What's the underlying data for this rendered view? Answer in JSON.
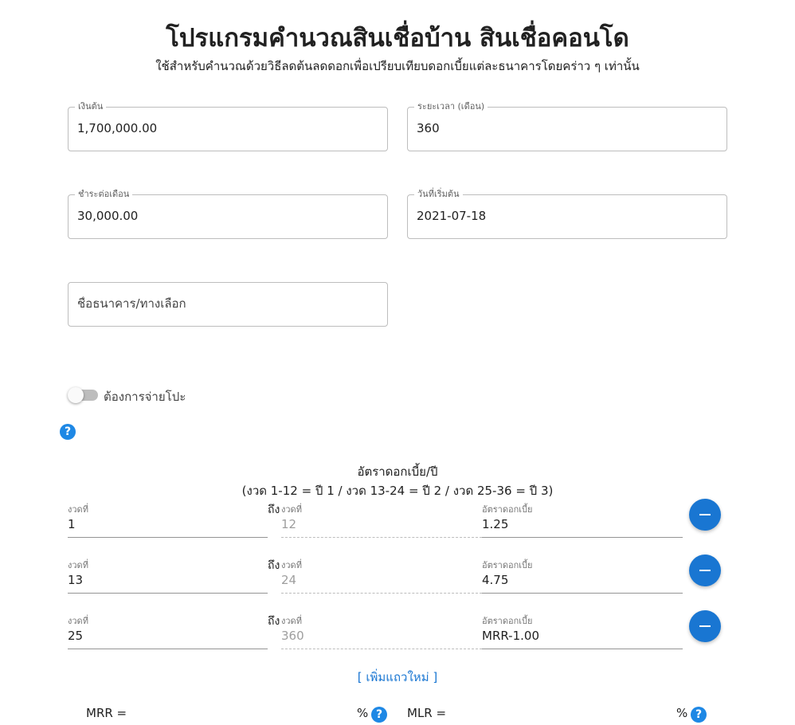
{
  "header": {
    "title": "โปรแกรมคำนวณสินเชื่อบ้าน สินเชื่อคอนโด",
    "subtitle": "ใช้สำหรับคำนวณด้วยวิธีลดต้นลดดอกเพื่อเปรียบเทียบดอกเบี้ยแต่ละธนาคารโดยคร่าว ๆ เท่านั้น"
  },
  "form": {
    "principal": {
      "label": "เงินต้น",
      "value": "1,700,000.00"
    },
    "duration": {
      "label": "ระยะเวลา (เดือน)",
      "value": "360"
    },
    "payment": {
      "label": "ชำระต่อเดือน",
      "value": "30,000.00"
    },
    "start_date": {
      "label": "วันที่เริ่มต้น",
      "value": "2021-07-18"
    },
    "bank_name": {
      "placeholder": "ชื่อธนาคาร/ทางเลือก",
      "value": ""
    }
  },
  "toggle": {
    "label": "ต้องการจ่ายโปะ",
    "on": false
  },
  "rates": {
    "title": "อัตราดอกเบี้ย/ปี",
    "note": "(งวด 1-12 = ปี 1 / งวด 13-24 = ปี 2 / งวด 25-36 = ปี 3)",
    "from_label": "งวดที่",
    "to_word": "ถึง",
    "to_label": "งวดที่",
    "rate_label": "อัตราดอกเบี้ย",
    "rows": [
      {
        "from": "1",
        "to": "12",
        "rate": "1.25"
      },
      {
        "from": "13",
        "to": "24",
        "rate": "4.75"
      },
      {
        "from": "25",
        "to": "360",
        "rate": "MRR-1.00"
      }
    ],
    "add_row": "[ เพิ่มแถวใหม่ ]"
  },
  "refs": {
    "mrr_label": "MRR =",
    "mlr_label": "MLR =",
    "unit": "%"
  },
  "colors": {
    "accent": "#1976d2",
    "help": "#1e88e5",
    "text": "#212121"
  }
}
